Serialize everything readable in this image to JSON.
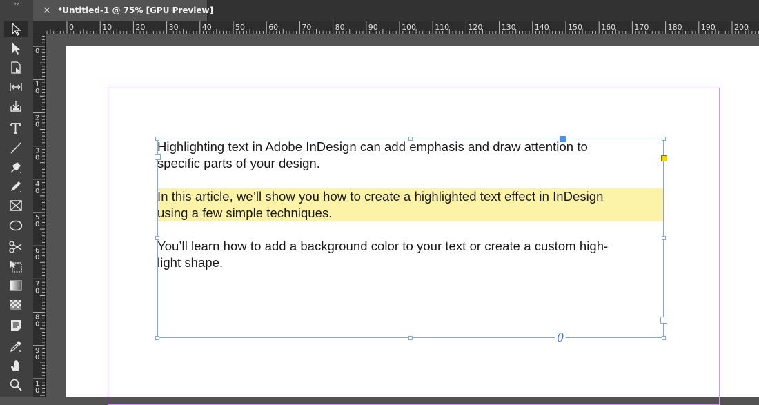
{
  "document_tab": {
    "close_symbol": "×",
    "title": "*Untitled-1 @ 75% [GPU Preview]"
  },
  "toolbar": {
    "grip": "››",
    "tools": [
      {
        "name": "selection-tool",
        "active": true
      },
      {
        "name": "direct-selection-tool"
      },
      {
        "name": "page-tool"
      },
      {
        "name": "gap-tool"
      },
      {
        "name": "content-collector-tool"
      },
      {
        "name": "type-tool"
      },
      {
        "name": "line-tool"
      },
      {
        "name": "pen-tool"
      },
      {
        "name": "pencil-tool"
      },
      {
        "name": "rectangle-frame-tool"
      },
      {
        "name": "ellipse-tool"
      },
      {
        "name": "scissors-tool"
      },
      {
        "name": "free-transform-tool"
      },
      {
        "name": "gradient-swatch-tool"
      },
      {
        "name": "gradient-feather-tool"
      },
      {
        "name": "note-tool"
      },
      {
        "name": "eyedropper-tool"
      },
      {
        "name": "hand-tool"
      },
      {
        "name": "zoom-tool"
      }
    ]
  },
  "rulers": {
    "horizontal_labels": [
      "0",
      "10",
      "20",
      "30",
      "40",
      "50",
      "60",
      "70",
      "80",
      "90",
      "100",
      "110",
      "120",
      "130",
      "140",
      "150",
      "160",
      "170",
      "180",
      "190",
      "200"
    ],
    "vertical_labels": [
      "0",
      "10",
      "20",
      "30",
      "40",
      "50",
      "60",
      "70",
      "80",
      "90",
      "10"
    ]
  },
  "text_frame": {
    "paragraph_1": "Highlighting text in Adobe InDesign can add emphasis and draw attention to specific parts of your design.",
    "paragraph_2": "In this article, we’ll show you how to create a highlighted text effect in InDesign using a few simple techniques.",
    "paragraph_3": "You’ll learn how to add a background color to your text or create a custom high-light shape.",
    "paragraph_1_lines": [
      "Highlighting text in Adobe InDesign can add emphasis and draw attention to",
      "specific parts of your design."
    ],
    "paragraph_2_lines": [
      "In this article, we’ll show you how to create a highlighted text effect in InDesign",
      "using a few simple techniques."
    ],
    "paragraph_3_lines": [
      "You’ll learn how to add a background color to your text or create a custom high-",
      "light shape."
    ],
    "highlight_color": "#fdf3a8",
    "overset_symbol": "0"
  },
  "colors": {
    "margin_guide": "#e489ff",
    "frame_edge": "#7fa9e6",
    "interface": "#535353"
  }
}
